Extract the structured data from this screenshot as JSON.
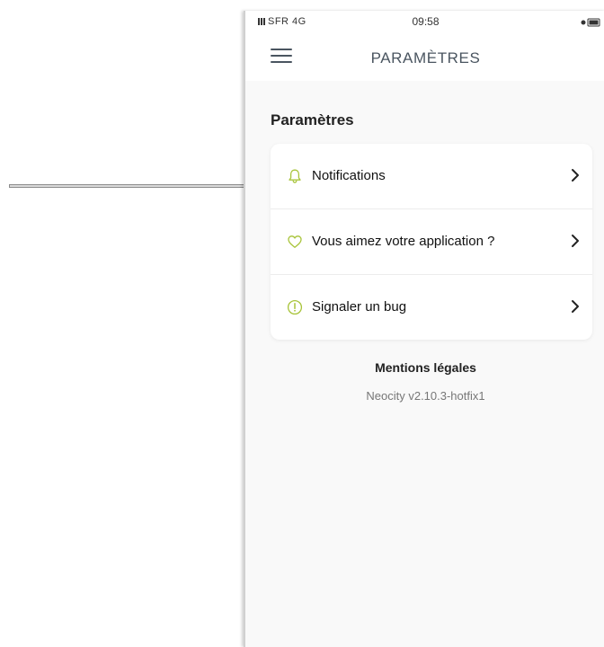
{
  "statusbar": {
    "carrier": "SFR 4G",
    "time": "09:58"
  },
  "navbar": {
    "title": "PARAMÈTRES",
    "menu_icon": "hamburger-menu-icon"
  },
  "section": {
    "title": "Paramètres"
  },
  "settings": {
    "items": [
      {
        "label": "Notifications",
        "icon": "bell-icon"
      },
      {
        "label": "Vous aimez votre application ?",
        "icon": "heart-icon"
      },
      {
        "label": "Signaler un bug",
        "icon": "alert-circle-icon"
      }
    ]
  },
  "footer": {
    "legal": "Mentions légales",
    "version": "Neocity v2.10.3-hotfix1"
  },
  "colors": {
    "accent": "#a8c43a",
    "nav_text": "#4a5560",
    "background": "#f9f9f9",
    "annotation_arrow": "#8c8c8c"
  }
}
